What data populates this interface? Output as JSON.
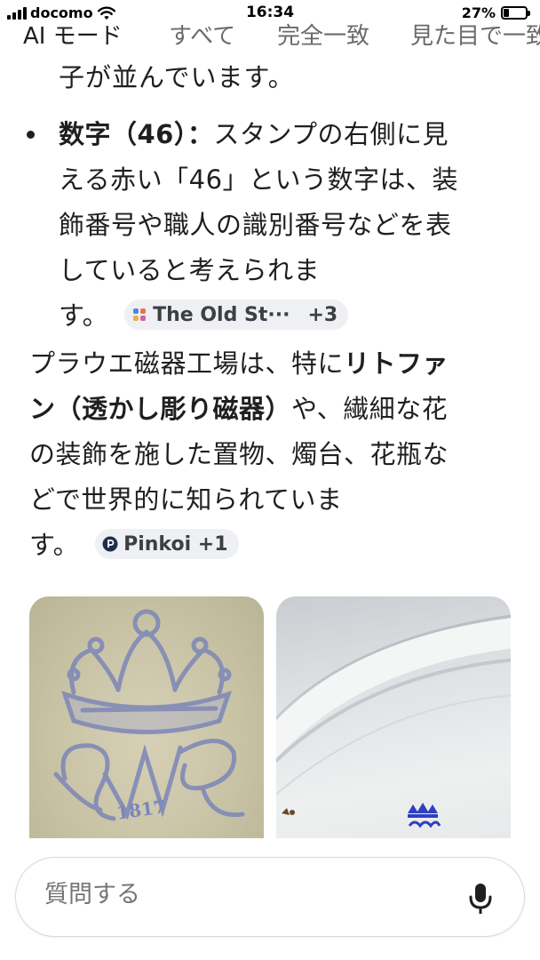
{
  "status_bar": {
    "carrier": "docomo",
    "time": "16:34",
    "battery_percent": "27%",
    "battery_level": 0.27,
    "icons": [
      "signal-icon",
      "wifi-icon",
      "battery-icon"
    ]
  },
  "tabs": [
    {
      "label": "AI モード",
      "active": true
    },
    {
      "label": "すべて",
      "active": false
    },
    {
      "label": "完全一致",
      "active": false
    },
    {
      "label": "見た目で一致",
      "active": false
    }
  ],
  "content": {
    "clipped_line": "子が並んでいます。",
    "bullet": {
      "title": "数字（46）：",
      "line1_rest": "スタンプの右側に見",
      "line2": "える赤い「46」という数字は、装",
      "line3": "飾番号や職人の識別番号などを表",
      "line4": "していると考えられま",
      "line5": "す。",
      "source_chip": {
        "label": "The Old St···",
        "more": "+3",
        "icon": "source-favicon-icon"
      }
    },
    "paragraph": {
      "line1_plain": "プラウエ磁器工場は、特に",
      "line1_bold": "リトファ",
      "line2_bold": "ン（透かし彫り磁器）",
      "line2_plain": "や、繊細な花",
      "line3": "の装飾を施した置物、燭台、花瓶な",
      "line4": "どで世界的に知られていま",
      "line5": "す。",
      "source_chip": {
        "label": "Pinkoi +1",
        "icon": "pinkoi-icon"
      }
    },
    "images": [
      {
        "name": "porcelain-mark-closeup-image",
        "mark_year": "1817"
      },
      {
        "name": "plate-underside-image"
      }
    ]
  },
  "search_bar": {
    "placeholder": "質問する",
    "mic_icon": "microphone-icon"
  },
  "colors": {
    "text": "#1f1f1f",
    "muted_tab": "#6a6a6a",
    "chip_bg": "#eef0f4",
    "mark_blue": "#6f7fb6"
  }
}
